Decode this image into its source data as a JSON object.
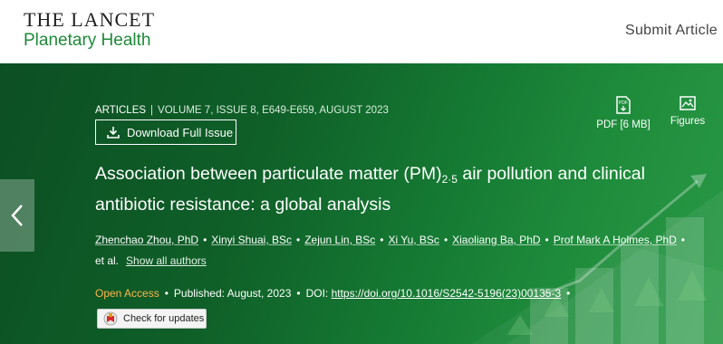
{
  "header": {
    "logo_top": "THE LANCET",
    "logo_bottom": "Planetary Health",
    "submit_label": "Submit Article"
  },
  "article": {
    "type": "ARTICLES",
    "details": "VOLUME 7, ISSUE 8, E649-E659, AUGUST 2023",
    "download_label": "Download Full Issue",
    "pdf_label": "PDF [6 MB]",
    "figures_label": "Figures",
    "title_before": "Association between particulate matter (PM)",
    "title_sub": "2·5",
    "title_after": " air pollution and clinical antibiotic resistance: a global analysis",
    "authors": [
      "Zhenchao Zhou, PhD",
      "Xinyi Shuai, BSc",
      "Zejun Lin, BSc",
      "Xi Yu, BSc",
      "Xiaoliang Ba, PhD",
      "Prof Mark A Holmes, PhD"
    ],
    "et_al": "et al.",
    "show_all": "Show all authors",
    "open_access": "Open Access",
    "published_label": "Published:",
    "published_date": "August, 2023",
    "doi_label": "DOI:",
    "doi_url": "https://doi.org/10.1016/S2542-5196(23)00135-3",
    "check_updates": "Check for updates"
  },
  "icons": {
    "download": "download-icon",
    "pdf": "pdf-icon",
    "figures": "image-icon",
    "prev": "chevron-left-icon",
    "crossmark": "crossmark-icon"
  },
  "colors": {
    "brand_green": "#1f8a3a",
    "hero_dark": "#0c4f23",
    "open_access": "#ffb44c"
  }
}
